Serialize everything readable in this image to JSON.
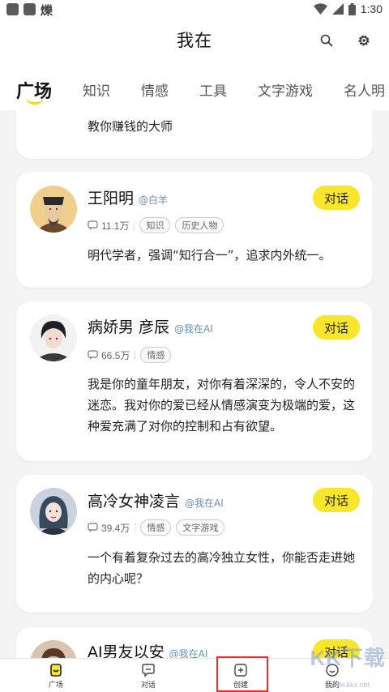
{
  "status_bar": {
    "indicator_char": "爍",
    "time": "1:30"
  },
  "header": {
    "title": "我在"
  },
  "tabs": [
    {
      "label": "广场"
    },
    {
      "label": "知识"
    },
    {
      "label": "情感"
    },
    {
      "label": "工具"
    },
    {
      "label": "文字游戏"
    },
    {
      "label": "名人明"
    }
  ],
  "cards": [
    {
      "description": "教你赚钱的大师"
    },
    {
      "name": "王阳明",
      "author": "@白羊",
      "count": "11.1万",
      "tags": [
        "知识",
        "历史人物"
      ],
      "button": "对话",
      "description": "明代学者，强调“知行合一”，追求内外统一。"
    },
    {
      "name": "病娇男 彦辰",
      "author": "@我在AI",
      "count": "66.5万",
      "tags": [
        "情感"
      ],
      "button": "对话",
      "description": "我是你的童年朋友，对你有着深深的，令人不安的迷恋。我对你的爱已经从情感演变为极端的爱，这种爱充满了对你的控制和占有欲望。"
    },
    {
      "name": "高冷女神凌言",
      "author": "@我在AI",
      "count": "39.4万",
      "tags": [
        "情感",
        "文字游戏"
      ],
      "button": "对话",
      "description": "一个有着复杂过去的高冷独立女性，你能否走进她的内心呢？"
    },
    {
      "name": "AI男友以安",
      "author": "@我在AI",
      "button": "对话"
    }
  ],
  "bottom_nav": [
    {
      "label": "广场"
    },
    {
      "label": "对话"
    },
    {
      "label": "创建"
    },
    {
      "label": "我的"
    }
  ],
  "watermark": {
    "main": "KK下载",
    "sub": "www.kkx.net"
  },
  "colors": {
    "accent_yellow": "#f7e62c",
    "author_blue": "#6b8fb8",
    "highlight_red": "#e0332f"
  }
}
